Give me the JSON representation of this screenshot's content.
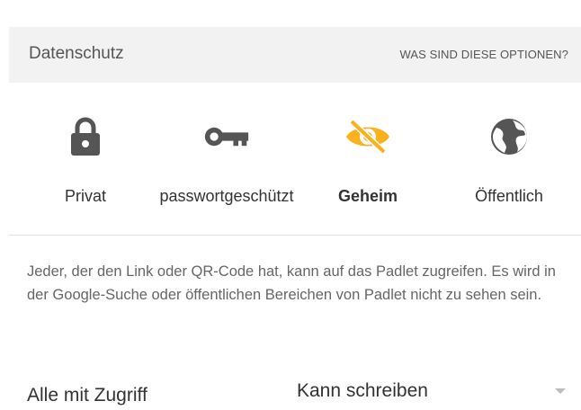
{
  "header": {
    "title": "Datenschutz",
    "help_link": "WAS SIND DIESE OPTIONEN?"
  },
  "privacy_options": [
    {
      "label": "Privat",
      "icon": "lock-icon",
      "selected": false
    },
    {
      "label": "passwortgeschützt",
      "icon": "key-icon",
      "selected": false
    },
    {
      "label": "Geheim",
      "icon": "eye-off-icon",
      "selected": true
    },
    {
      "label": "Öffentlich",
      "icon": "globe-icon",
      "selected": false
    }
  ],
  "description": "Jeder, der den Link oder QR-Code hat, kann auf das Padlet zugreifen. Es wird in der Google-Suche oder öffentlichen Bereichen von Padlet nicht zu sehen sein.",
  "access": {
    "label": "Alle mit Zugriff",
    "value": "Kann schreiben"
  },
  "colors": {
    "selected_accent": "#fbb11c",
    "icon_default": "#555555"
  }
}
